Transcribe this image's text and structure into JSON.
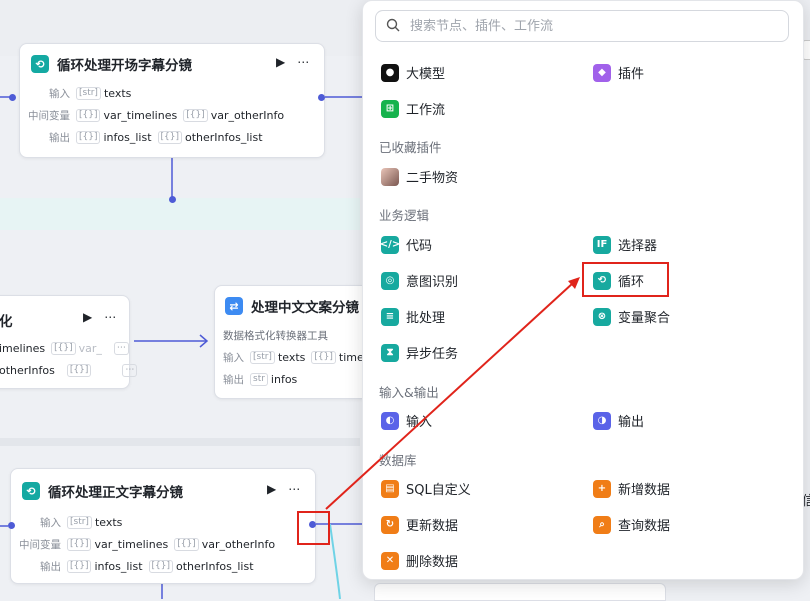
{
  "canvas": {
    "node1": {
      "title": "循环处理开场字幕分镜",
      "rows": [
        {
          "label": "输入",
          "chips": [
            {
              "type": "[str]",
              "name": "texts"
            }
          ]
        },
        {
          "label": "中间变量",
          "chips": [
            {
              "type": "[{}]",
              "name": "var_timelines"
            },
            {
              "type": "[{}]",
              "name": "var_otherInfo"
            }
          ]
        },
        {
          "label": "输出",
          "chips": [
            {
              "type": "[{}]",
              "name": "infos_list"
            },
            {
              "type": "[{}]",
              "name": "otherInfos_list"
            }
          ]
        }
      ]
    },
    "node2": {
      "title": "化",
      "rows": [
        {
          "chips": [
            {
              "name": "imelines"
            },
            {
              "type": "[{}]",
              "name": "var_"
            }
          ]
        },
        {
          "chips": [
            {
              "name": "otherInfos"
            },
            {
              "type": "[{}]",
              "name": ""
            }
          ]
        }
      ]
    },
    "node3": {
      "title": "处理中文文案分镜",
      "subtitle": "数据格式化转换器工具",
      "rows": [
        {
          "label": "输入",
          "chips": [
            {
              "type": "[str]",
              "name": "texts"
            },
            {
              "type": "[{}]",
              "name": "timelines"
            }
          ]
        },
        {
          "label": "输出",
          "chips": [
            {
              "type": "str",
              "name": "infos"
            }
          ]
        }
      ]
    },
    "node4": {
      "title": "循环处理正文字幕分镜",
      "rows": [
        {
          "label": "输入",
          "chips": [
            {
              "type": "[str]",
              "name": "texts"
            }
          ]
        },
        {
          "label": "中间变量",
          "chips": [
            {
              "type": "[{}]",
              "name": "var_timelines"
            },
            {
              "type": "[{}]",
              "name": "var_otherInfo"
            }
          ]
        },
        {
          "label": "输出",
          "chips": [
            {
              "type": "[{}]",
              "name": "infos_list"
            },
            {
              "type": "[{}]",
              "name": "otherInfos_list"
            }
          ]
        }
      ]
    },
    "right_edge_text": "信"
  },
  "menu": {
    "search_placeholder": "搜索节点、插件、工作流",
    "top_items": [
      {
        "label": "大模型",
        "icon": "llm-icon"
      },
      {
        "label": "插件",
        "icon": "plugin-icon"
      },
      {
        "label": "工作流",
        "icon": "workflow-icon"
      }
    ],
    "favorites_title": "已收藏插件",
    "favorites": [
      {
        "label": "二手物资",
        "icon": "plugin-avatar"
      }
    ],
    "logic_title": "业务逻辑",
    "logic_items": [
      {
        "label": "代码",
        "icon": "code-icon"
      },
      {
        "label": "选择器",
        "icon": "selector-icon"
      },
      {
        "label": "意图识别",
        "icon": "intent-icon"
      },
      {
        "label": "循环",
        "icon": "loop-icon"
      },
      {
        "label": "批处理",
        "icon": "batch-icon"
      },
      {
        "label": "变量聚合",
        "icon": "aggregate-icon"
      },
      {
        "label": "异步任务",
        "icon": "async-icon"
      }
    ],
    "io_title": "输入&输出",
    "io_items": [
      {
        "label": "输入",
        "icon": "input-icon"
      },
      {
        "label": "输出",
        "icon": "output-icon"
      }
    ],
    "db_title": "数据库",
    "db_items": [
      {
        "label": "SQL自定义",
        "icon": "sql-icon"
      },
      {
        "label": "新增数据",
        "icon": "db-add-icon"
      },
      {
        "label": "更新数据",
        "icon": "db-update-icon"
      },
      {
        "label": "查询数据",
        "icon": "db-query-icon"
      },
      {
        "label": "删除数据",
        "icon": "db-delete-icon"
      }
    ]
  },
  "colors": {
    "accent_teal": "#17a99f",
    "annotation_red": "#e0241b",
    "connector": "#4e5bd6"
  }
}
